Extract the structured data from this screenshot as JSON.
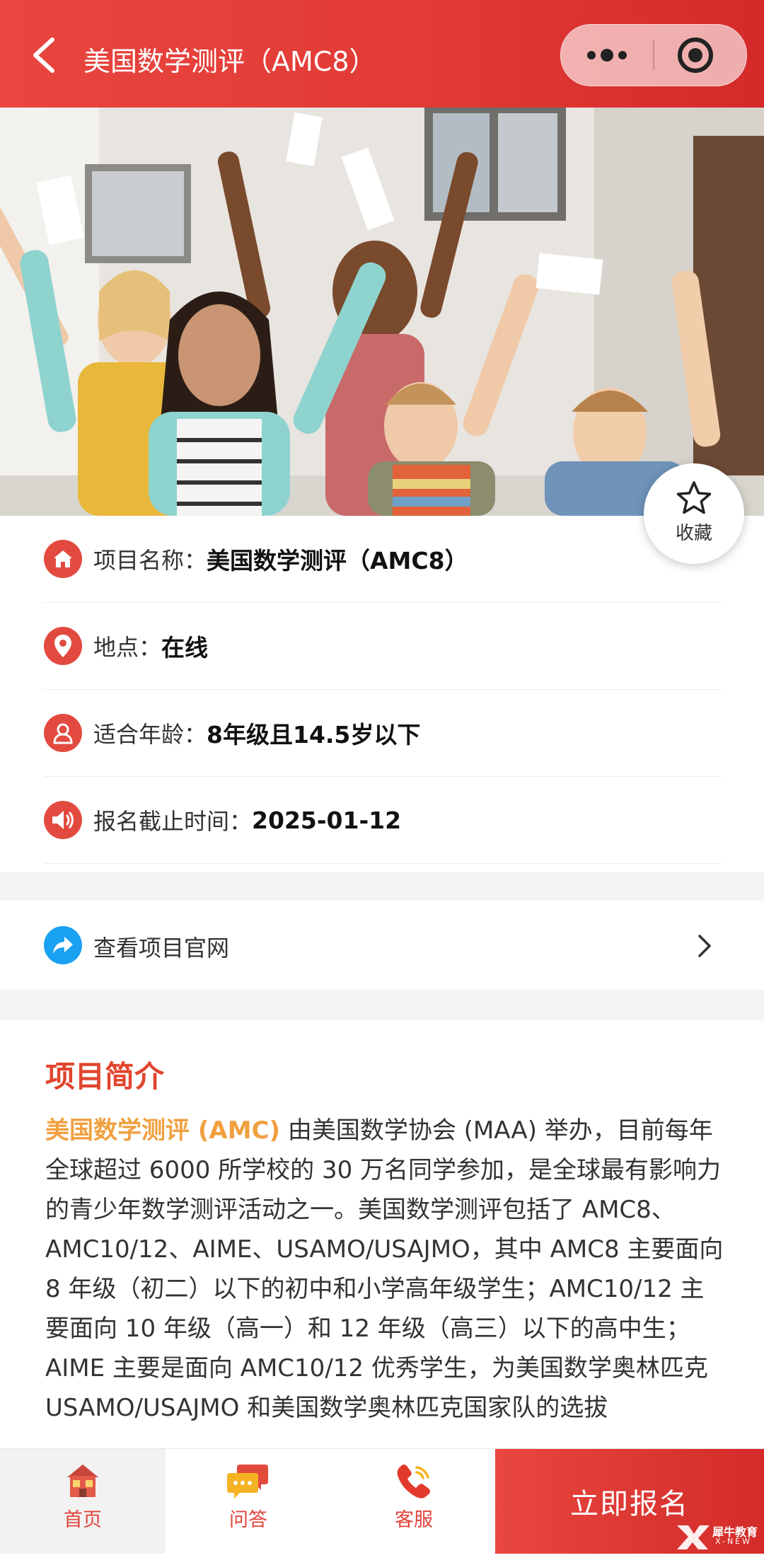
{
  "header": {
    "title": "美国数学测评（AMC8）"
  },
  "hero": {
    "favorite_label": "收藏"
  },
  "info": {
    "rows": [
      {
        "icon": "home-icon",
        "label": "项目名称：",
        "value": "美国数学测评（AMC8）"
      },
      {
        "icon": "location-pin-icon",
        "label": "地点：",
        "value": "在线"
      },
      {
        "icon": "user-icon",
        "label": "适合年龄：",
        "value": "8年级且14.5岁以下"
      },
      {
        "icon": "speaker-icon",
        "label": "报名截止时间：",
        "value": "2025-01-12"
      }
    ]
  },
  "website": {
    "label": "查看项目官网"
  },
  "intro": {
    "title": "项目简介",
    "highlight": "美国数学测评 (AMC)",
    "body": " 由美国数学协会 (MAA) 举办，目前每年全球超过 6000 所学校的 30 万名同学参加，是全球最有影响力的青少年数学测评活动之一。美国数学测评包括了 AMC8、AMC10/12、AIME、USAMO/USAJMO，其中 AMC8 主要面向 8 年级（初二）以下的初中和小学高年级学生；AMC10/12 主要面向 10 年级（高一）和 12 年级（高三）以下的高中生；AIME 主要是面向 AMC10/12 优秀学生，为美国数学奥林匹克 USAMO/USAJMO 和美国数学奥林匹克国家队的选拔"
  },
  "tabbar": {
    "home": "首页",
    "qa": "问答",
    "service": "客服",
    "signup": "立即报名"
  },
  "watermark": {
    "text": "犀牛教育",
    "sub": "X-NEW"
  },
  "colors": {
    "header": "#e23a35",
    "accent_red": "#e34a3f",
    "title_red": "#e0462e",
    "highlight_orange": "#f0a040",
    "link_blue": "#1ba1f2"
  }
}
